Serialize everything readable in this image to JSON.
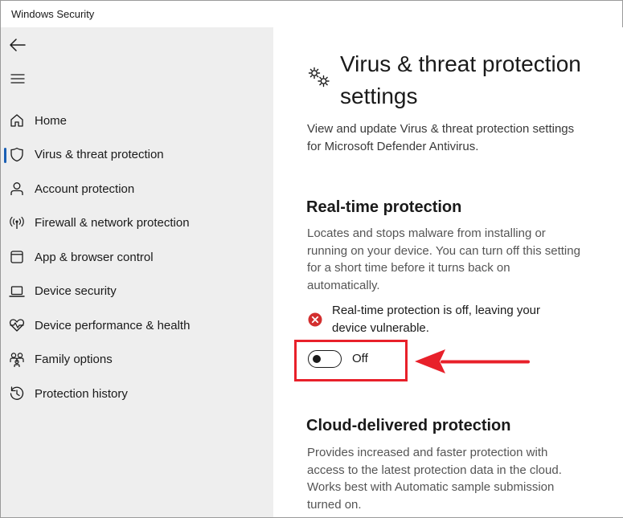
{
  "window": {
    "title": "Windows Security"
  },
  "sidebar": {
    "back_icon": "back-arrow-icon",
    "menu_icon": "hamburger-menu-icon",
    "items": [
      {
        "label": "Home",
        "icon": "home-icon"
      },
      {
        "label": "Virus & threat protection",
        "icon": "shield-icon",
        "active": true
      },
      {
        "label": "Account protection",
        "icon": "person-icon"
      },
      {
        "label": "Firewall & network protection",
        "icon": "antenna-icon"
      },
      {
        "label": "App & browser control",
        "icon": "app-window-icon"
      },
      {
        "label": "Device security",
        "icon": "laptop-icon"
      },
      {
        "label": "Device performance & health",
        "icon": "heart-pulse-icon"
      },
      {
        "label": "Family options",
        "icon": "family-icon"
      },
      {
        "label": "Protection history",
        "icon": "history-icon"
      }
    ]
  },
  "main": {
    "title_icon": "gears-icon",
    "title": "Virus & threat protection settings",
    "description": "View and update Virus & threat protection settings for Microsoft Defender Antivirus.",
    "realtime": {
      "title": "Real-time protection",
      "description": "Locates and stops malware from installing or running on your device. You can turn off this setting for a short time before it turns back on automatically.",
      "warning_icon": "error-x-icon",
      "warning": "Real-time protection is off, leaving your device vulnerable.",
      "toggle_state": "Off",
      "toggle_on": false
    },
    "cloud": {
      "title": "Cloud-delivered protection",
      "description": "Provides increased and faster protection with access to the latest protection data in the cloud. Works best with Automatic sample submission turned on."
    }
  },
  "colors": {
    "sidebar_bg": "#eeeeee",
    "accent": "#1a5fb4",
    "error": "#d32f2f",
    "annotation": "#e8202a"
  }
}
